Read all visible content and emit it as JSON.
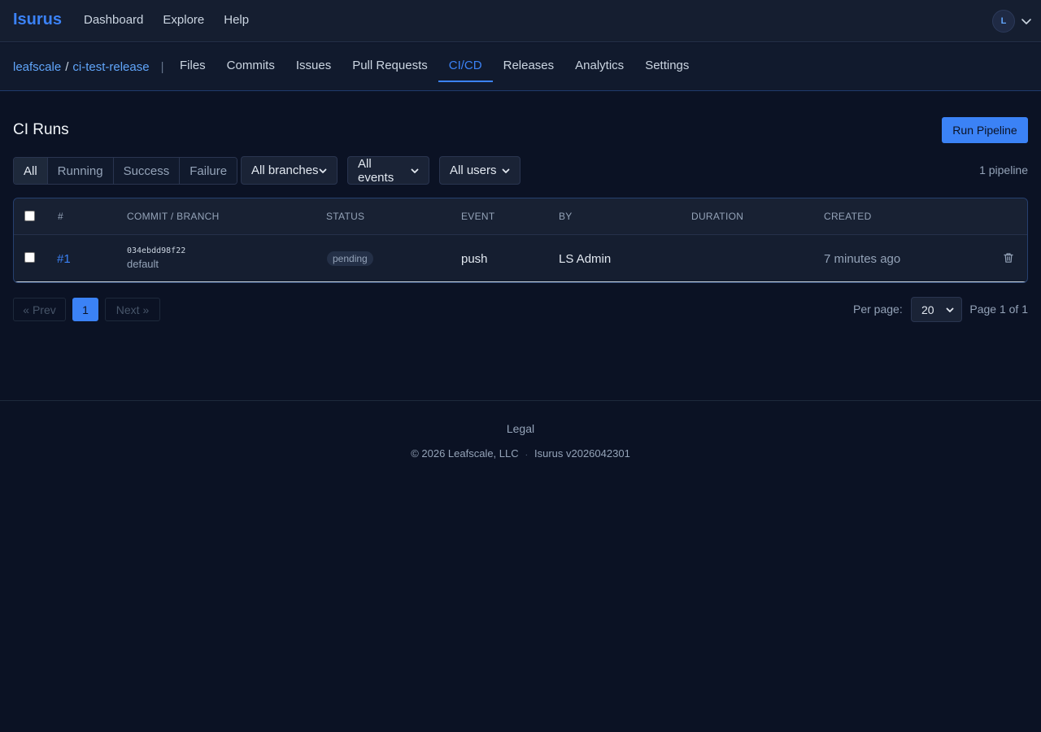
{
  "topbar": {
    "brand": "Isurus",
    "nav": [
      "Dashboard",
      "Explore",
      "Help"
    ],
    "avatar_initial": "L"
  },
  "repo": {
    "owner": "leafscale",
    "separator": "/",
    "name": "ci-test-release",
    "pipe": "|",
    "tabs": [
      "Files",
      "Commits",
      "Issues",
      "Pull Requests",
      "CI/CD",
      "Releases",
      "Analytics",
      "Settings"
    ],
    "active_tab": "CI/CD"
  },
  "page": {
    "title": "CI Runs",
    "run_button": "Run Pipeline"
  },
  "filters": {
    "status_tabs": [
      "All",
      "Running",
      "Success",
      "Failure"
    ],
    "active_status": "All",
    "branch": "All branches",
    "event": "All events",
    "user": "All users",
    "count": "1 pipeline"
  },
  "table": {
    "headers": [
      "#",
      "COMMIT / BRANCH",
      "STATUS",
      "EVENT",
      "BY",
      "DURATION",
      "CREATED"
    ],
    "rows": [
      {
        "number": "#1",
        "commit": "034ebdd98f22",
        "branch": "default",
        "status": "pending",
        "event": "push",
        "by": "LS Admin",
        "duration": "",
        "created": "7 minutes ago"
      }
    ]
  },
  "pagination": {
    "prev": "« Prev",
    "current": "1",
    "next": "Next »",
    "per_page_label": "Per page:",
    "per_page": "20",
    "page_of": "Page 1 of 1"
  },
  "footer": {
    "legal": "Legal",
    "copyright": "© 2026 Leafscale, LLC",
    "separator": "·",
    "version": "Isurus v2026042301"
  },
  "colors": {
    "accent": "#3b82f6",
    "background": "#0b1224",
    "surface": "#151e30"
  }
}
